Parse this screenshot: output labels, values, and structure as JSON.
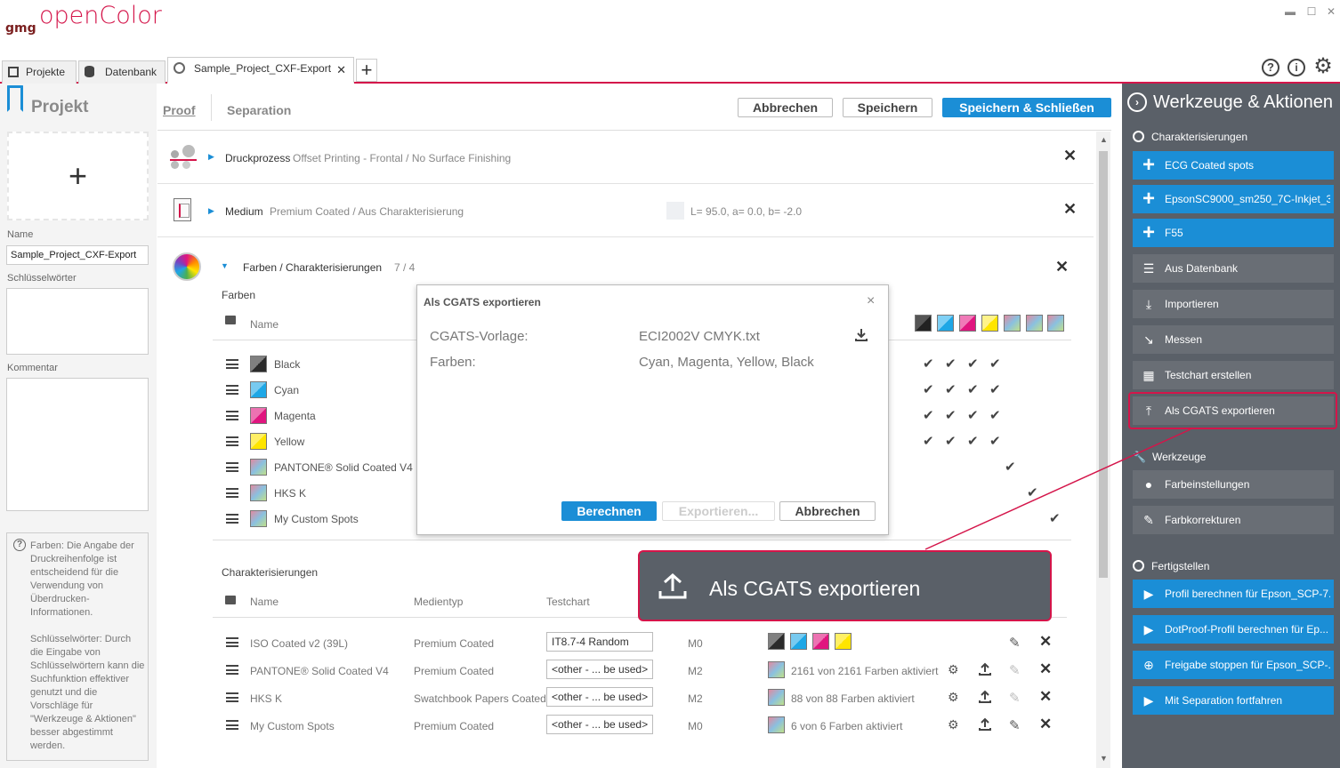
{
  "app": {
    "brand_gmg": "gmg",
    "brand_name": "openColor"
  },
  "window": {
    "minimize": "▬",
    "maximize": "☐",
    "close": "✕"
  },
  "tabs": [
    {
      "label": "Projekte"
    },
    {
      "label": "Datenbank"
    },
    {
      "label": "Sample_Project_CXF-Export",
      "close": "✕"
    }
  ],
  "tabs_add": "+",
  "toolbar_icons": {
    "help": "?",
    "info": "i",
    "settings": "⚙"
  },
  "project": {
    "title": "Projekt",
    "add": "+",
    "name_label": "Name",
    "name_value": "Sample_Project_CXF-Export",
    "keywords_label": "Schlüsselwörter",
    "comment_label": "Kommentar",
    "help_text": "Farben: Die Angabe der Druckreihenfolge ist entscheidend für die Verwendung von Überdrucken-Informationen.\n\nSchlüsselwörter: Durch die Eingabe von Schlüsselwörtern kann die Suchfunktion effektiver genutzt und die Vorschläge für \"Werkzeuge & Aktionen\" besser abgestimmt werden."
  },
  "subtabs": {
    "proof": "Proof",
    "separation": "Separation"
  },
  "actions": {
    "cancel": "Abbrechen",
    "save": "Speichern",
    "save_close": "Speichern & Schließen"
  },
  "druckprozess": {
    "label": "Druckprozess",
    "detail": "Offset Printing - Frontal / No Surface Finishing"
  },
  "medium": {
    "label": "Medium",
    "detail": "Premium Coated / Aus Charakterisierung",
    "lab": "L= 95.0, a= 0.0, b= -2.0"
  },
  "farben_section": {
    "label": "Farben / Charakterisierungen",
    "count": "7 / 4",
    "subheading": "Farben",
    "name_col": "Name",
    "items": [
      {
        "name": "Black",
        "color": "#2b2b2b"
      },
      {
        "name": "Cyan",
        "color": "#1ea7e6"
      },
      {
        "name": "Magenta",
        "color": "#e0157f"
      },
      {
        "name": "Yellow",
        "color": "#ffe500"
      },
      {
        "name": "PANTONE® Solid Coated V4",
        "color": "multi"
      },
      {
        "name": "HKS K",
        "color": "multi"
      },
      {
        "name": "My Custom Spots",
        "color": "multi"
      }
    ]
  },
  "charakterisierungen": {
    "heading": "Charakterisierungen",
    "cols": {
      "name": "Name",
      "medientyp": "Medientyp",
      "testchart": "Testchart"
    },
    "rows": [
      {
        "name": "ISO Coated v2 (39L)",
        "medium": "Premium Coated",
        "chart": "IT8.7-4 Random",
        "mode": "M0",
        "info": ""
      },
      {
        "name": "PANTONE® Solid Coated V4",
        "medium": "Premium Coated",
        "chart": "<other - ... be used>",
        "mode": "M2",
        "info": "2161 von 2161 Farben aktiviert"
      },
      {
        "name": "HKS K",
        "medium": "Swatchbook Papers Coated",
        "chart": "<other - ... be used>",
        "mode": "M2",
        "info": "88 von 88 Farben aktiviert"
      },
      {
        "name": "My Custom Spots",
        "medium": "Premium Coated",
        "chart": "<other - ... be used>",
        "mode": "M0",
        "info": "6 von 6 Farben aktiviert"
      }
    ]
  },
  "dialog": {
    "title": "Als CGATS exportieren",
    "close": "×",
    "template_label": "CGATS-Vorlage:",
    "template_value": "ECI2002V CMYK.txt",
    "colors_label": "Farben:",
    "colors_value": "Cyan, Magenta, Yellow, Black",
    "calc": "Berechnen",
    "export": "Exportieren...",
    "cancel": "Abbrechen"
  },
  "callout": {
    "label": "Als CGATS exportieren"
  },
  "right": {
    "title": "Werkzeuge & Aktionen",
    "char_heading": "Charakterisierungen",
    "char_items": [
      {
        "label": "ECG Coated spots",
        "icon": "+"
      },
      {
        "label": "EpsonSC9000_sm250_7C-Inkjet_3",
        "icon": "+"
      },
      {
        "label": "F55",
        "icon": "+"
      }
    ],
    "actions": [
      {
        "label": "Aus Datenbank"
      },
      {
        "label": "Importieren"
      },
      {
        "label": "Messen"
      },
      {
        "label": "Testchart erstellen"
      },
      {
        "label": "Als CGATS exportieren"
      }
    ],
    "tools_heading": "Werkzeuge",
    "tools": [
      {
        "label": "Farbeinstellungen"
      },
      {
        "label": "Farbkorrekturen"
      }
    ],
    "finish_heading": "Fertigstellen",
    "finish": [
      {
        "label": "Profil berechnen für Epson_SCP-7..."
      },
      {
        "label": "DotProof-Profil berechnen für Ep..."
      },
      {
        "label": "Freigabe stoppen für Epson_SCP-..."
      },
      {
        "label": "Mit Separation fortfahren"
      }
    ]
  },
  "colors": {
    "accent": "#d4154a",
    "primary": "#1b8ed6",
    "panel": "#5a6068"
  }
}
